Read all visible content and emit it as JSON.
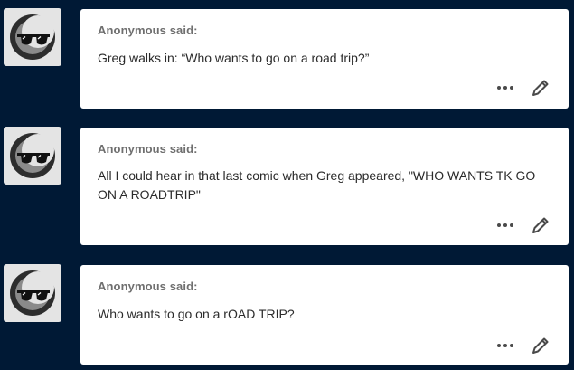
{
  "colors": {
    "page_background": "#001935",
    "card_background": "#ffffff",
    "avatar_background": "#e4e4e4",
    "asker_text": "#6f6f6f",
    "message_text": "#2b2b2b",
    "icon": "#4a4a4a"
  },
  "asks": [
    {
      "asker": "Anonymous said:",
      "message": "Greg walks in: “Who wants to go on a road trip?”",
      "avatar_icon": "anonymous-sunglasses-icon",
      "more_icon": "more-dots-icon",
      "edit_icon": "pencil-icon"
    },
    {
      "asker": "Anonymous said:",
      "message": "All I could hear in that last comic when Greg appeared, \"WHO WANTS TK GO ON A ROADTRIP\"",
      "avatar_icon": "anonymous-sunglasses-icon",
      "more_icon": "more-dots-icon",
      "edit_icon": "pencil-icon"
    },
    {
      "asker": "Anonymous said:",
      "message": "Who wants to go on a rOAD TRIP?",
      "avatar_icon": "anonymous-sunglasses-icon",
      "more_icon": "more-dots-icon",
      "edit_icon": "pencil-icon"
    }
  ]
}
